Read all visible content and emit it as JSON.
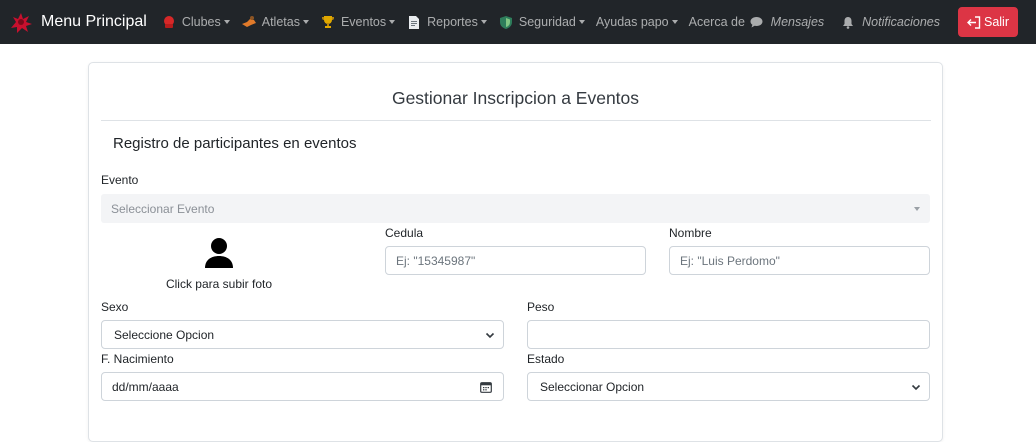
{
  "navbar": {
    "brand": "Menu Principal",
    "items": [
      {
        "label": "Clubes",
        "icon": "boxing-glove-icon"
      },
      {
        "label": "Atletas",
        "icon": "athlete-icon"
      },
      {
        "label": "Eventos",
        "icon": "trophy-icon"
      },
      {
        "label": "Reportes",
        "icon": "document-icon"
      },
      {
        "label": "Seguridad",
        "icon": "shield-icon"
      },
      {
        "label": "Ayudas papo",
        "icon": ""
      },
      {
        "label": "Acerca de",
        "icon": ""
      }
    ],
    "messages": "Mensajes",
    "notifications": "Notificaciones",
    "logout": "Salir"
  },
  "card": {
    "title": "Gestionar Inscripcion a Eventos",
    "section_title": "Registro de participantes en eventos"
  },
  "form": {
    "evento_label": "Evento",
    "evento_placeholder": "Seleccionar Evento",
    "photo_text": "Click para subir foto",
    "cedula_label": "Cedula",
    "cedula_placeholder": "Ej: \"15345987\"",
    "nombre_label": "Nombre",
    "nombre_placeholder": "Ej: \"Luis Perdomo\"",
    "sexo_label": "Sexo",
    "sexo_value": "Seleccione Opcion",
    "peso_label": "Peso",
    "peso_value": "",
    "nacimiento_label": "F. Nacimiento",
    "nacimiento_value": "dd/mm/aaaa",
    "estado_label": "Estado",
    "estado_value": "Seleccionar Opcion"
  },
  "colors": {
    "navbar": "#212529",
    "danger": "#dc3545",
    "accent": "#c8102e"
  }
}
